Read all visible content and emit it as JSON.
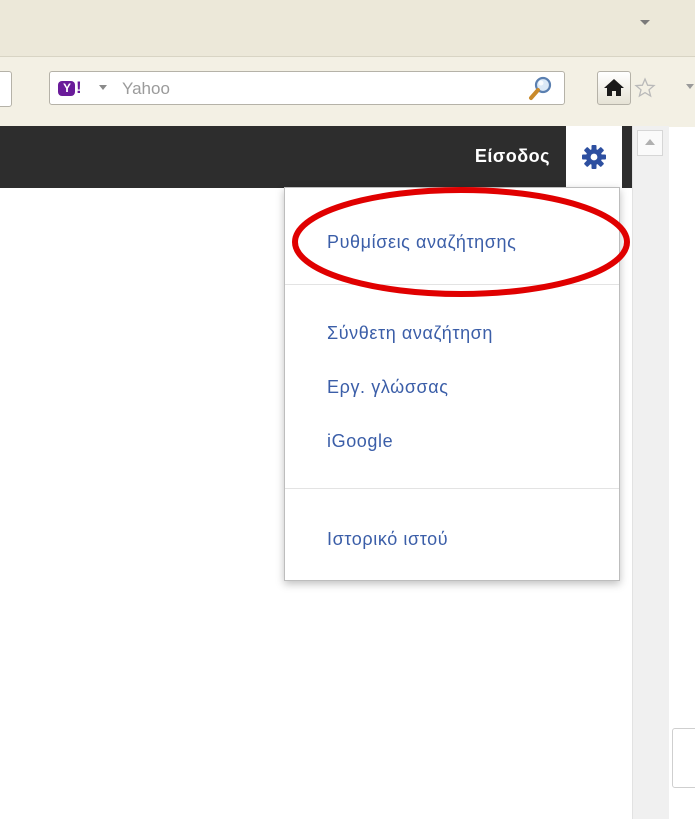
{
  "browser": {
    "search_engine_logo": "Y!",
    "search_placeholder": "Yahoo",
    "search_icon": "magnifier-icon",
    "home_icon": "home-icon",
    "bookmark_icon": "star-icon"
  },
  "google_bar": {
    "signin_label": "Είσοδος",
    "settings_icon": "gear-icon"
  },
  "settings_menu": {
    "items": [
      {
        "label": "Ρυθμίσεις αναζήτησης"
      },
      {
        "label": "Σύνθετη αναζήτηση"
      },
      {
        "label": "Εργ. γλώσσας"
      },
      {
        "label": "iGoogle"
      },
      {
        "label": "Ιστορικό ιστού"
      }
    ]
  },
  "annotation": {
    "highlight_color": "#e00000"
  },
  "colors": {
    "bar_background": "#2d2d2d",
    "link_color": "#3b5ea8",
    "gear_color": "#2d4fa0"
  }
}
